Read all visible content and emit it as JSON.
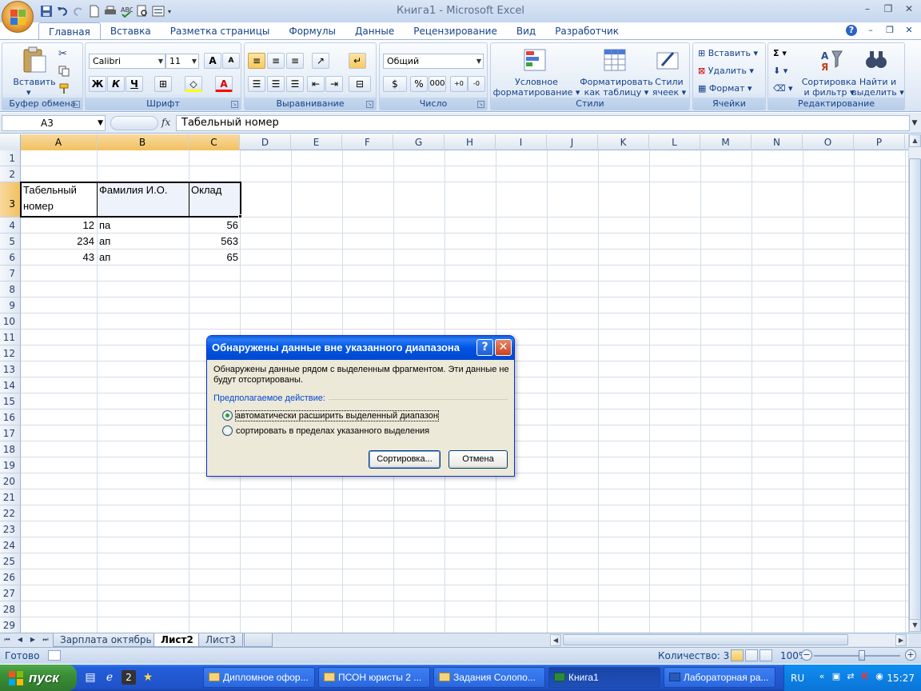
{
  "window": {
    "title": "Книга1 - Microsoft Excel",
    "controls": [
      "–",
      "❐",
      "✕"
    ],
    "inner_controls": [
      "–",
      "❐",
      "✕"
    ]
  },
  "ribbon_tabs": [
    "Главная",
    "Вставка",
    "Разметка страницы",
    "Формулы",
    "Данные",
    "Рецензирование",
    "Вид",
    "Разработчик"
  ],
  "active_tab": "Главная",
  "ribbon": {
    "clipboard": {
      "label": "Буфер обмена",
      "paste": "Вставить"
    },
    "font": {
      "label": "Шрифт",
      "name": "Calibri",
      "size": "11",
      "bold": "Ж",
      "italic": "К",
      "underline": "Ч",
      "grow": "A",
      "shrink": "A"
    },
    "alignment": {
      "label": "Выравнивание"
    },
    "number": {
      "label": "Число",
      "format": "Общий",
      "percent": "%",
      "thousands": "000"
    },
    "styles": {
      "label": "Стили",
      "cond_format": [
        "Условное",
        "форматирование ▾"
      ],
      "format_table": [
        "Форматировать",
        "как таблицу ▾"
      ],
      "cell_styles": [
        "Стили",
        "ячеек ▾"
      ]
    },
    "cells": {
      "label": "Ячейки",
      "insert": "Вставить ▾",
      "delete": "Удалить ▾",
      "format": "Формат ▾"
    },
    "editing": {
      "label": "Редактирование",
      "sigma": "Σ",
      "sort": [
        "Сортировка",
        "и фильтр ▾"
      ],
      "find": [
        "Найти и",
        "выделить ▾"
      ]
    }
  },
  "formula_bar": {
    "name_box": "A3",
    "fx": "fx",
    "value": "Табельный номер"
  },
  "columns": [
    "A",
    "B",
    "C",
    "D",
    "E",
    "F",
    "G",
    "H",
    "I",
    "J",
    "K",
    "L",
    "M",
    "N",
    "O",
    "P"
  ],
  "rows": [
    "1",
    "2",
    "3",
    "4",
    "5",
    "6",
    "7",
    "8",
    "9",
    "10",
    "11",
    "12",
    "13",
    "14",
    "15",
    "16",
    "17",
    "18",
    "19",
    "20",
    "21",
    "22",
    "23",
    "24",
    "25",
    "26",
    "27",
    "28",
    "29"
  ],
  "cells": {
    "A3": "Табельный номер",
    "B3": "Фамилия И.О.",
    "C3": "Оклад",
    "A4": "12",
    "B4": "па",
    "C4": "56",
    "A5": "234",
    "B5": "ап",
    "C5": "563",
    "A6": "43",
    "B6": "ап",
    "C6": "65"
  },
  "sheet_tabs": [
    "Зарплата октябрь",
    "Лист2",
    "Лист3"
  ],
  "active_sheet": "Лист2",
  "status": {
    "ready": "Готово",
    "count": "Количество: 3",
    "zoom": "100%"
  },
  "dialog": {
    "title": "Обнаружены данные вне указанного диапазона",
    "message": "Обнаружены данные рядом с выделенным фрагментом. Эти данные не будут отсортированы.",
    "group_label": "Предполагаемое действие:",
    "options": [
      "автоматически расширить выделенный диапазон",
      "сортировать в пределах указанного выделения"
    ],
    "selected_option": 0,
    "sort_button": "Сортировка...",
    "cancel_button": "Отмена",
    "help": "?",
    "close": "✕"
  },
  "taskbar": {
    "start": "пуск",
    "windows": [
      "Дипломное офор...",
      "ПСОН юристы 2 ...",
      "Задания Солопо...",
      "Книга1",
      "Лабораторная ра..."
    ],
    "active_window": "Книга1",
    "language": "RU",
    "clock": "15:27"
  },
  "colors": {
    "accent": "#15428b",
    "selection_header": "#f1c15f",
    "dialog_title": "#0054e3",
    "taskbar": "#245edb"
  }
}
